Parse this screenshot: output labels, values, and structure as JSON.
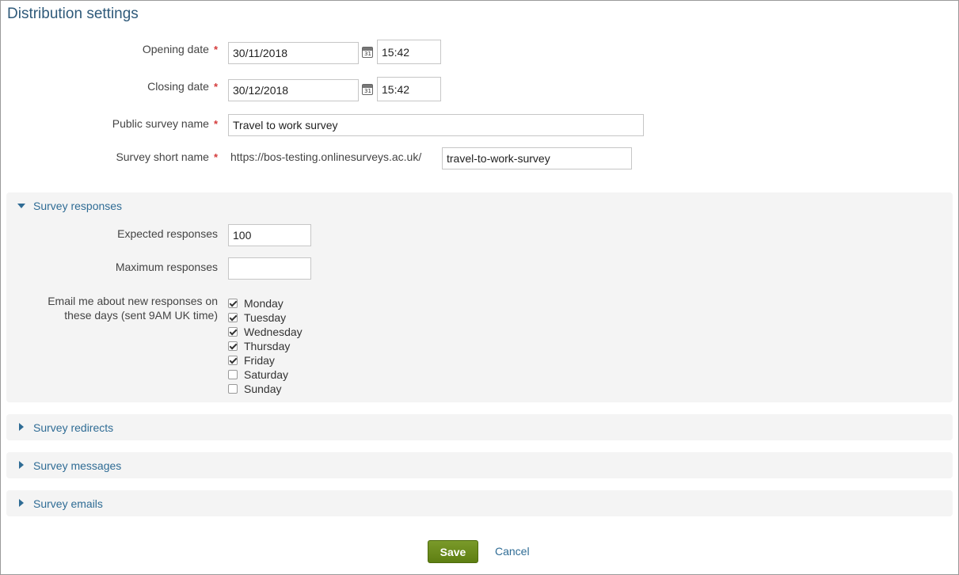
{
  "page": {
    "title": "Distribution settings"
  },
  "form": {
    "opening_date": {
      "label": "Opening date",
      "date": "30/11/2018",
      "time": "15:42",
      "required_mark": "*"
    },
    "closing_date": {
      "label": "Closing date",
      "date": "30/12/2018",
      "time": "15:42",
      "required_mark": "*"
    },
    "public_name": {
      "label": "Public survey name",
      "value": "Travel to work survey",
      "required_mark": "*"
    },
    "short_name": {
      "label": "Survey short name",
      "prefix": "https://bos-testing.onlinesurveys.ac.uk/",
      "value": "travel-to-work-survey",
      "required_mark": "*"
    }
  },
  "calendar_icon_text": "31",
  "responses_panel": {
    "title": "Survey responses",
    "expected": {
      "label": "Expected responses",
      "value": "100"
    },
    "maximum": {
      "label": "Maximum responses",
      "value": ""
    },
    "email": {
      "label_line1": "Email me about new responses on",
      "label_line2": "these days (sent 9AM UK time)",
      "days": [
        {
          "name": "Monday",
          "checked": true
        },
        {
          "name": "Tuesday",
          "checked": true
        },
        {
          "name": "Wednesday",
          "checked": true
        },
        {
          "name": "Thursday",
          "checked": true
        },
        {
          "name": "Friday",
          "checked": true
        },
        {
          "name": "Saturday",
          "checked": false
        },
        {
          "name": "Sunday",
          "checked": false
        }
      ]
    }
  },
  "panels": {
    "redirects": "Survey redirects",
    "messages": "Survey messages",
    "emails": "Survey emails"
  },
  "actions": {
    "save": "Save",
    "cancel": "Cancel"
  },
  "colors": {
    "accent": "#2f6c95",
    "required": "#d43a3a",
    "save_button": "#6a8a1c"
  },
  "icons": {
    "expanded": "caret-down-icon",
    "collapsed": "caret-right-icon",
    "calendar": "calendar-icon"
  }
}
